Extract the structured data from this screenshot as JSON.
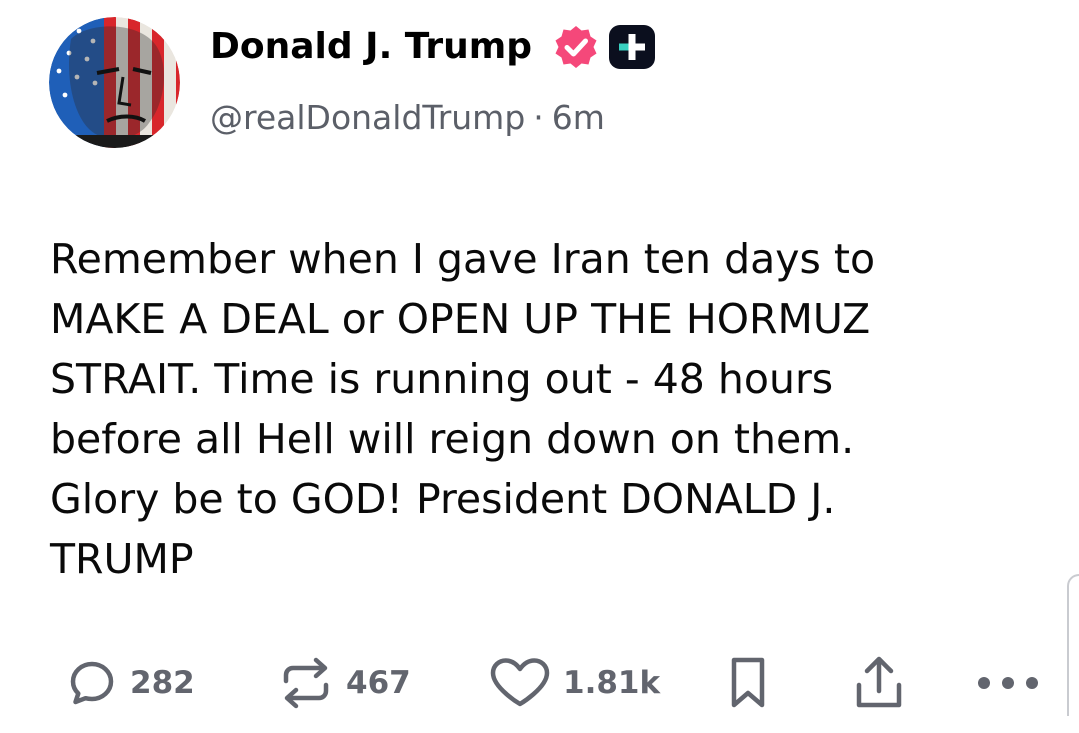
{
  "post": {
    "author_name": "Donald J. Trump",
    "handle": "@realDonaldTrump",
    "separator": "·",
    "time_ago": "6m",
    "body": "Remember when I gave Iran ten days to\nMAKE A DEAL or OPEN UP THE HORMUZ\nSTRAIT. Time is running out - 48 hours\nbefore all Hell will reign down on them.\nGlory be to GOD! President DONALD J.\nTRUMP"
  },
  "actions": {
    "replies": "282",
    "reposts": "467",
    "likes": "1.81k"
  },
  "icons": {
    "avatar": "avatar-flag-portrait",
    "verified": "verified-badge-icon",
    "plus": "plus-badge-icon",
    "reply": "comment-icon",
    "repost": "repost-icon",
    "like": "heart-icon",
    "bookmark": "bookmark-icon",
    "share": "share-icon",
    "more": "more-icon"
  },
  "colors": {
    "verified": "#f5487a",
    "action_gray": "#62656e",
    "meta_gray": "#5b5f68",
    "plus_badge_bg": "#0b0f1e",
    "plus_badge_accent": "#38d0c0"
  }
}
